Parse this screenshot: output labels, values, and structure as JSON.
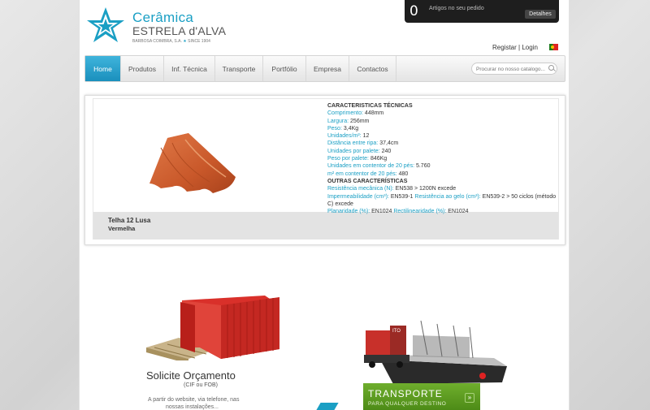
{
  "cart": {
    "count": "0",
    "label": "Artigos no seu pedido",
    "details_button": "Detalhes"
  },
  "logo": {
    "line1": "Cerâmica",
    "line2": "ESTRELA d'ALVA",
    "tagline_left": "BARBOSA COIMBRA, S.A.",
    "tagline_star": "★",
    "tagline_right": "SINCE 1904"
  },
  "top_links": {
    "register": "Registar",
    "separator": "|",
    "login": "Login"
  },
  "nav": {
    "items": [
      "Home",
      "Produtos",
      "Inf. Técnica",
      "Transporte",
      "Portfólio",
      "Empresa",
      "Contactos"
    ],
    "active": "Home"
  },
  "search": {
    "placeholder": "Procurar no nosso catalogo..."
  },
  "product": {
    "name": "Telha 12 Lusa",
    "color": "Vermelha",
    "tech_title": "CARACTERISTICAS TÉCNICAS",
    "tech": [
      {
        "label": "Comprimento:",
        "value": "448mm"
      },
      {
        "label": "Largura:",
        "value": "256mm"
      },
      {
        "label": "Peso:",
        "value": "3,4Kg"
      },
      {
        "label": "Unidades/m²:",
        "value": "12"
      },
      {
        "label": "Distância entre ripa:",
        "value": "37,4cm"
      },
      {
        "label": "Unidades por palete:",
        "value": "240"
      },
      {
        "label": "Peso por palete:",
        "value": "846Kg"
      },
      {
        "label": "Unidades em contentor de 20 pés:",
        "value": "5.760"
      },
      {
        "label": "m² em contentor de 20 pés:",
        "value": "480"
      }
    ],
    "other_title": "OUTRAS CARACTERÍSTICAS",
    "other": {
      "mech_label": "Resistência mecânica (N):",
      "mech_value": "EN538 > 1200N excede",
      "imp_label": "Impermeabilidade (cm³):",
      "imp_value": "EN539-1",
      "frost_label": "Resistência ao gelo (cm³):",
      "frost_value": "EN539-2 > 50 ciclos (método C) excede",
      "flat_label": "Planaridade (%):",
      "flat_value": "EN1024",
      "rect_label": "Rectilinearidade (%):",
      "rect_value": "EN1024"
    }
  },
  "promo_quote": {
    "title": "Solicite Orçamento",
    "subtitle": "(CIF ou FOB)",
    "desc_line1": "A partir do website, via telefone, nas",
    "desc_line2": "nossas instalações..."
  },
  "promo_transport": {
    "title": "TRANSPORTE",
    "subtitle": "PARA QUALQUER DESTINO",
    "arrow": "»",
    "container_code": "ITO"
  },
  "colors": {
    "accent": "#1a9fc4",
    "nav_active": "#2aa3cf",
    "transport_green": "#5a9a1f"
  }
}
